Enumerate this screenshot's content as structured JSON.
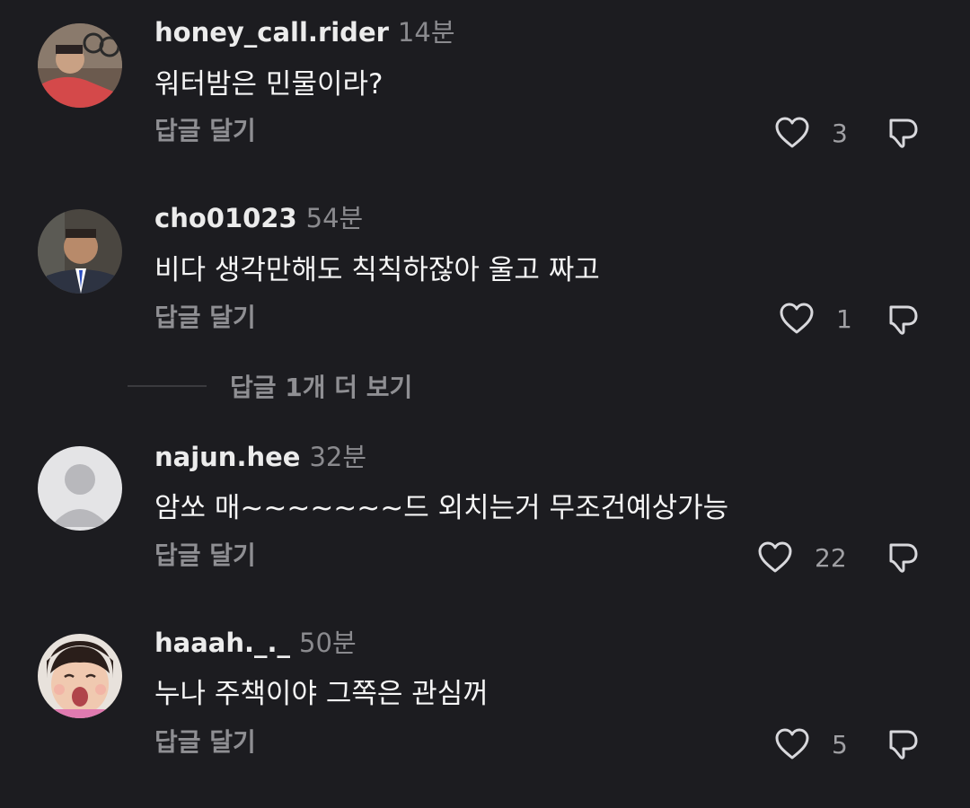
{
  "comments": [
    {
      "username": "honey_call.rider",
      "time": "14분",
      "text": "워터밤은 민물이라?",
      "reply_label": "답글 달기",
      "likes": "3"
    },
    {
      "username": "cho01023",
      "time": "54분",
      "text": "비다 생각만해도 칙칙하잖아 울고 짜고",
      "reply_label": "답글 달기",
      "likes": "1"
    },
    {
      "username": "najun.hee",
      "time": "32분",
      "text": "암쏘 매~~~~~~~드 외치는거 무조건예상가능",
      "reply_label": "답글 달기",
      "likes": "22"
    },
    {
      "username": "haaah._._",
      "time": "50분",
      "text": "누나 주책이야 그쪽은 관심꺼",
      "reply_label": "답글 달기",
      "likes": "5"
    }
  ],
  "more_replies_label": "답글 1개 더 보기",
  "icons": {
    "like": "heart-outline-icon",
    "dislike": "thumbs-down-outline-icon"
  },
  "colors": {
    "background": "#1c1c20",
    "username": "#ececec",
    "secondary_text": "#8f8f93"
  }
}
